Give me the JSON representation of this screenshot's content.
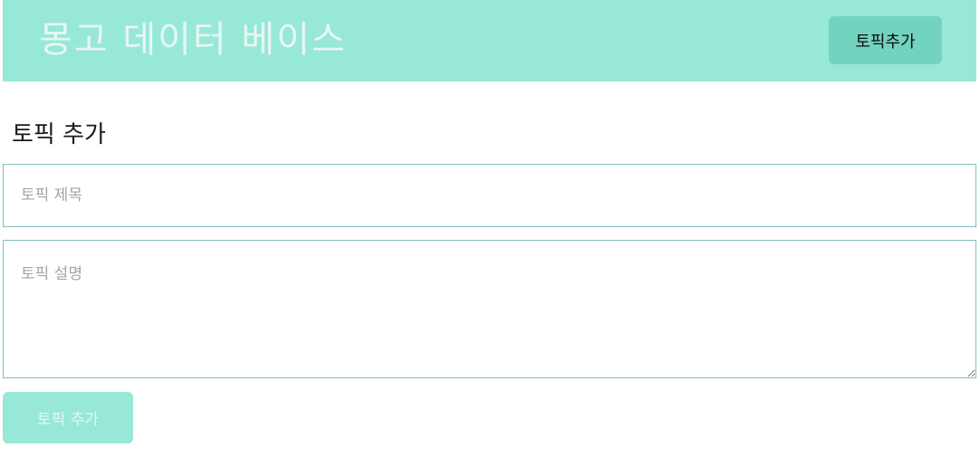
{
  "header": {
    "app_title": "몽고 데이터 베이스",
    "add_topic_label": "토픽추가"
  },
  "main": {
    "page_title": "토픽 추가",
    "title_placeholder": "토픽 제목",
    "title_value": "",
    "description_placeholder": "토픽 설명",
    "description_value": "",
    "submit_label": "토픽 추가"
  },
  "colors": {
    "header_bg": "#97e8d7",
    "header_button_bg": "#72d3bf",
    "input_border": "#7fbfbf",
    "submit_bg": "#97e8d7"
  }
}
